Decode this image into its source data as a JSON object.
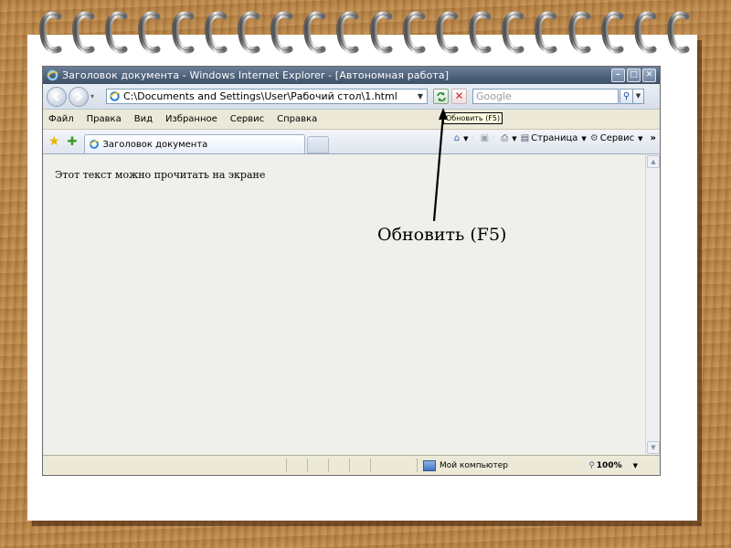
{
  "ie": {
    "title": "Заголовок документа - Windows Internet Explorer - [Автономная работа]",
    "window_buttons": [
      "–",
      "□",
      "✕"
    ],
    "address": "C:\\Documents and Settings\\User\\Рабочий стол\\1.html",
    "search_placeholder": "Google",
    "refresh_tooltip": "Обновить (F5)",
    "menu": [
      "Файл",
      "Правка",
      "Вид",
      "Избранное",
      "Сервис",
      "Справка"
    ],
    "tab_title": "Заголовок документа",
    "commands": {
      "page": "Страница",
      "tools": "Сервис",
      "more": "»"
    },
    "content_text": "Этот текст можно прочитать на экране",
    "status": {
      "zone": "Мой компьютер",
      "zoom": "100%"
    }
  },
  "annotation": {
    "label": "Обновить (F5)"
  },
  "icons": {
    "back": "back-arrow-icon",
    "forward": "forward-arrow-icon",
    "refresh": "refresh-icon",
    "stop": "stop-icon",
    "search": "magnifier-icon",
    "favorites": "star-icon",
    "add_favorites": "add-favorite-icon",
    "home": "home-icon",
    "feeds": "rss-icon",
    "print": "printer-icon",
    "zone": "computer-icon",
    "zoom": "magnifier-zoom-icon"
  },
  "colors": {
    "wood": "#b98548",
    "title_bar": "#4d6079",
    "paper": "#ffffff"
  }
}
